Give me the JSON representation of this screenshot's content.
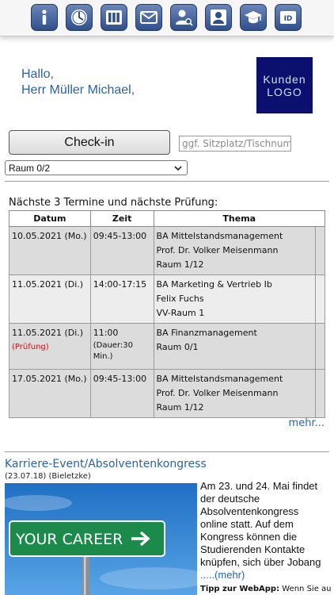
{
  "toolbar": {
    "icons": [
      "info-icon",
      "clock-icon",
      "schedule-icon",
      "mail-icon",
      "user-search-icon",
      "profile-icon",
      "graduation-icon",
      "id-card-icon"
    ],
    "id_label": "ID"
  },
  "greeting": {
    "line1": "Hallo,",
    "line2": "Herr Müller Michael,"
  },
  "logo": {
    "line1": "Kunden",
    "line2": "LOGO"
  },
  "checkin": {
    "button_label": "Check-in",
    "seat_placeholder": "ggf. Sitzplatz/Tischnummer",
    "room_selected": "Raum 0/2"
  },
  "appointments": {
    "title": "Nächste 3 Termine und nächste Prüfung:",
    "headers": [
      "Datum",
      "Zeit",
      "Thema"
    ],
    "rows": [
      {
        "date": "10.05.2021 (Mo.)",
        "time": "09:45-13:00",
        "topic": "BA Mittelstandsmanagement",
        "person": "Prof. Dr. Volker Meisenmann",
        "room": "Raum 1/12"
      },
      {
        "date": "11.05.2021 (Di.)",
        "time": "14:00-17:15",
        "topic": "BA Marketing & Vertrieb Ib",
        "person": "Felix Fuchs",
        "room": "VV-Raum 1"
      },
      {
        "date": "11.05.2021 (Di.)",
        "exam_label": "(Prüfung)",
        "time": "11:00",
        "duration": "(Dauer:30 Min.)",
        "topic": "BA Finanzmanagement",
        "room": "Raum 0/1"
      },
      {
        "date": "17.05.2021 (Mo.)",
        "time": "09:45-13:00",
        "topic": "BA Mittelstandsmanagement",
        "person": "Prof. Dr. Volker Meisenmann",
        "room": "Raum 1/12"
      }
    ],
    "more_label": "mehr..."
  },
  "news": {
    "title": "Karriere-Event/Absolventenkongress",
    "date": "(23.07.18)",
    "author": "(Bieletzke)",
    "image_sign_text": "YOUR CAREER",
    "body": "Am 23. und 24. Mai findet der deutsche Absolventenkongress online statt. Auf dem Kongress können die Studierenden Kontakte knüpfen, sich über Jobang",
    "more_link": ".....(mehr)",
    "tip_label": "Tipp zur WebApp:",
    "tip_text": "Wenn Sie auf"
  },
  "colors": {
    "accent": "#2a62a8",
    "toolbar_icon": "#2f4f8c",
    "logo_bg": "#0b0f6e",
    "exam": "#d01010"
  }
}
